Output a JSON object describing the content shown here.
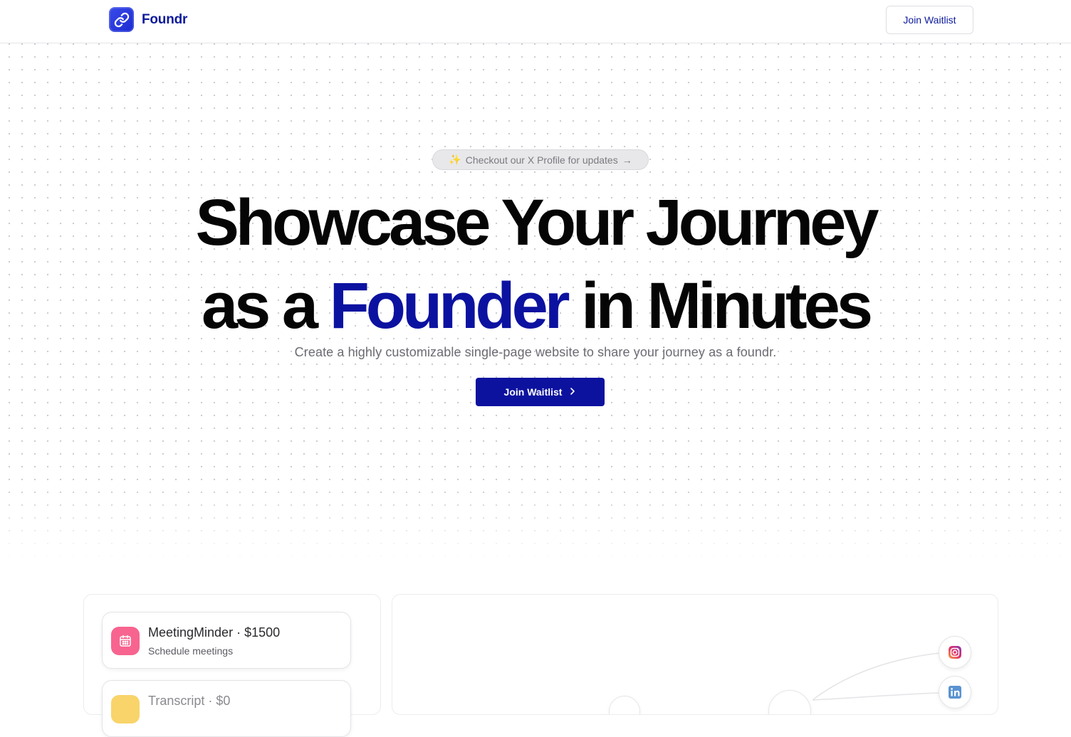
{
  "brand": {
    "name": "Foundr",
    "logo_icon": "link-icon",
    "color": "#0c1a9c"
  },
  "nav": {
    "waitlist_label": "Join Waitlist"
  },
  "announcement": {
    "icon": "sparkles-icon",
    "text": "Checkout our X Profile for updates",
    "arrow": "→"
  },
  "hero": {
    "line1": "Showcase Your Journey",
    "line2_prefix": "as a",
    "line2_accent": "Founder",
    "line2_suffix": "in Minutes",
    "accent_color": "#0c12a0",
    "subtitle": "Create a highly customizable single-page website to share your journey as a foundr.",
    "cta_label": "Join Waitlist",
    "cta_icon": "chevron-right-icon"
  },
  "products": [
    {
      "name": "MeetingMinder",
      "separator": "·",
      "price": "$1500",
      "description": "Schedule meetings",
      "icon": "calendar-icon",
      "color": "#f7648f"
    },
    {
      "name": "Transcript",
      "separator": "·",
      "price": "$0",
      "description": "",
      "icon": "document-icon",
      "color": "#f8d46a"
    }
  ],
  "socials": [
    {
      "name": "instagram",
      "icon": "instagram-icon"
    },
    {
      "name": "linkedin",
      "icon": "linkedin-icon"
    }
  ]
}
